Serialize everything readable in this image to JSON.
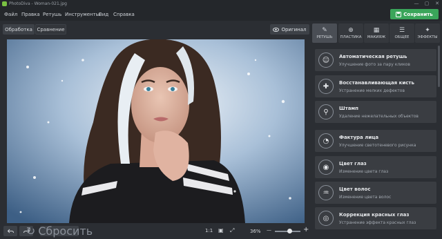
{
  "window": {
    "title": "PhotoDiva - Woman-021.jpg",
    "controls": [
      "—",
      "▢",
      "✕"
    ]
  },
  "menu": [
    "Файл",
    "Правка",
    "Ретушь",
    "Инструменты",
    "Вид",
    "Справка"
  ],
  "save_label": "Сохранить",
  "view_tabs": {
    "edit": "Обработка",
    "compare": "Сравнение"
  },
  "original_label": "Оригинал",
  "right_tabs": [
    {
      "label": "РЕТУШЬ",
      "icon": "retouch-brush-icon"
    },
    {
      "label": "ПЛАСТИКА",
      "icon": "liquify-icon"
    },
    {
      "label": "МАКИЯЖ",
      "icon": "makeup-icon"
    },
    {
      "label": "ОБЩЕЕ",
      "icon": "sliders-icon"
    },
    {
      "label": "ЭФФЕКТЫ",
      "icon": "effects-icon"
    }
  ],
  "tools": [
    {
      "title": "Автоматическая ретушь",
      "subtitle": "Улучшение фото за пару кликов",
      "icon": "auto-retouch-icon"
    },
    {
      "title": "Восстанавливающая кисть",
      "subtitle": "Устранение мелких дефектов",
      "icon": "healing-brush-icon"
    },
    {
      "title": "Штамп",
      "subtitle": "Удаление нежелательных объектов",
      "icon": "stamp-icon"
    },
    {
      "title": "Фактура лица",
      "subtitle": "Улучшение светотеневого рисунка",
      "icon": "face-texture-icon"
    },
    {
      "title": "Цвет глаз",
      "subtitle": "Изменение цвета глаз",
      "icon": "eye-color-icon"
    },
    {
      "title": "Цвет волос",
      "subtitle": "Изменение цвета волос",
      "icon": "hair-color-icon"
    },
    {
      "title": "Коррекция красных глаз",
      "subtitle": "Устранение эффекта красных глаз",
      "icon": "red-eye-icon"
    }
  ],
  "bottom": {
    "reset_label": "Сбросить",
    "ratio_label": "1:1",
    "zoom": "36%",
    "minus": "—",
    "plus": "+"
  },
  "colors": {
    "accent_green": "#3aa55a",
    "panel_bg": "#2b2e33",
    "card_bg": "#3a3d42"
  }
}
